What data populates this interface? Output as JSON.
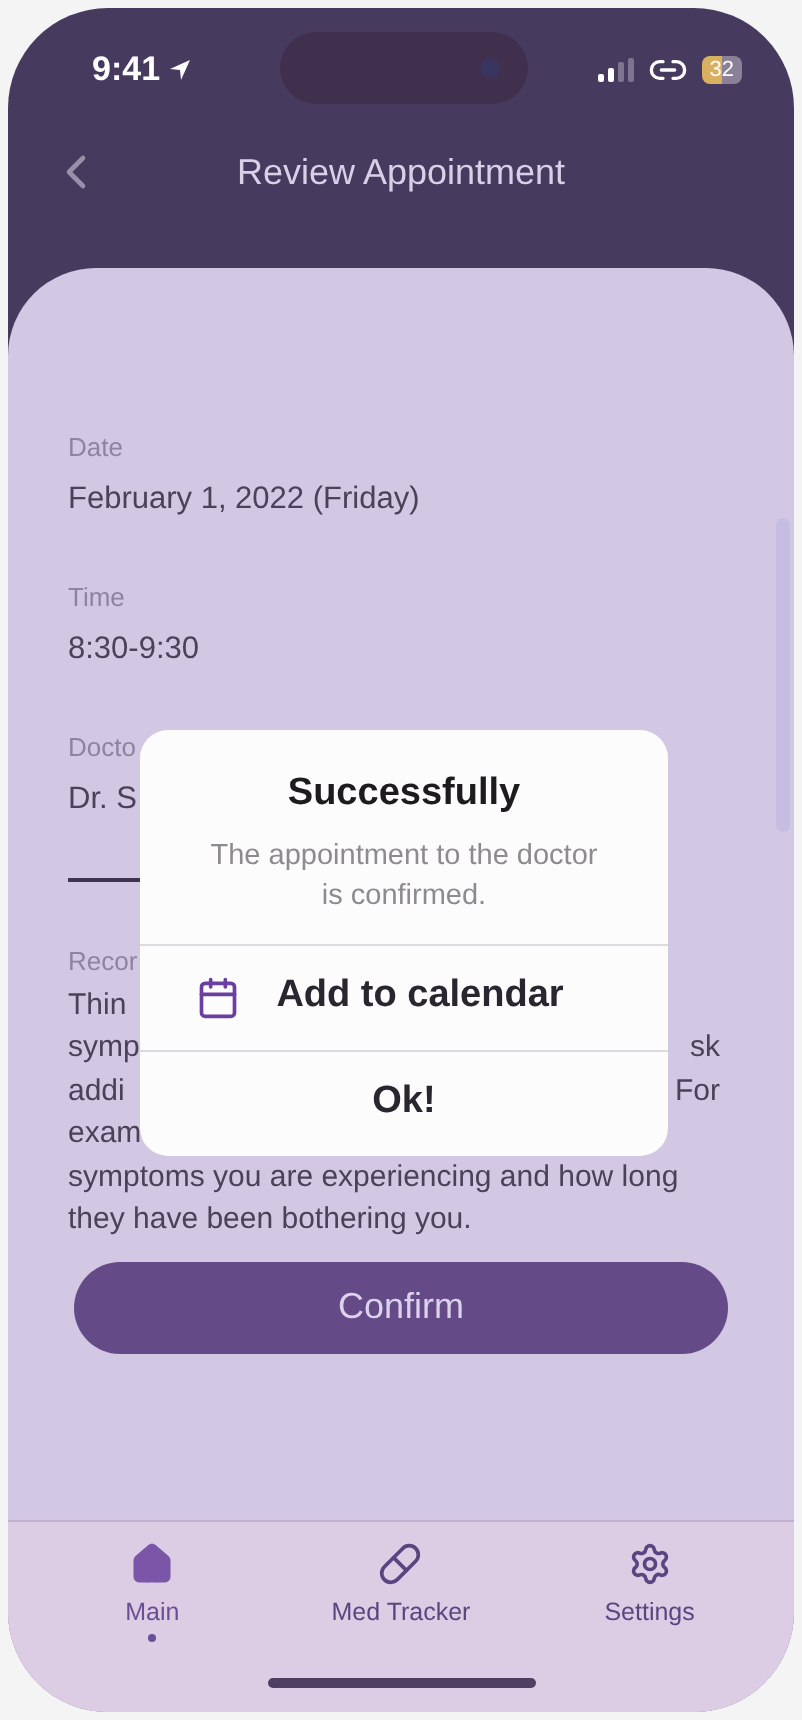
{
  "status_bar": {
    "time": "9:41",
    "battery": "32"
  },
  "header": {
    "title": "Review Appointment"
  },
  "fields": [
    {
      "label": "Date",
      "value": "February 1, 2022 (Friday)"
    },
    {
      "label": "Time",
      "value": "8:30-9:30"
    },
    {
      "label": "Docto",
      "value": "Dr. S"
    }
  ],
  "recommendations": {
    "label": "Recor",
    "lines": [
      {
        "left": "Thin"
      },
      {
        "left": "symp",
        "right": "sk"
      },
      {
        "left": "addi",
        "right": "For"
      },
      {
        "left": "exam"
      },
      {
        "left": "symptoms you are experiencing and how long"
      },
      {
        "left": "they have been bothering you."
      }
    ]
  },
  "confirm_button": "Confirm",
  "dialog": {
    "title": "Successfully",
    "message": "The appointment to the doctor is confirmed.",
    "actions": [
      {
        "kind": "calendar",
        "label": "Add to calendar"
      },
      {
        "kind": "plain",
        "label": "Ok!"
      }
    ]
  },
  "nav": [
    {
      "kind": "home",
      "label": "Main",
      "selected": true
    },
    {
      "kind": "pill",
      "label": "Med Tracker",
      "selected": false
    },
    {
      "kind": "settings",
      "label": "Settings",
      "selected": false
    }
  ]
}
